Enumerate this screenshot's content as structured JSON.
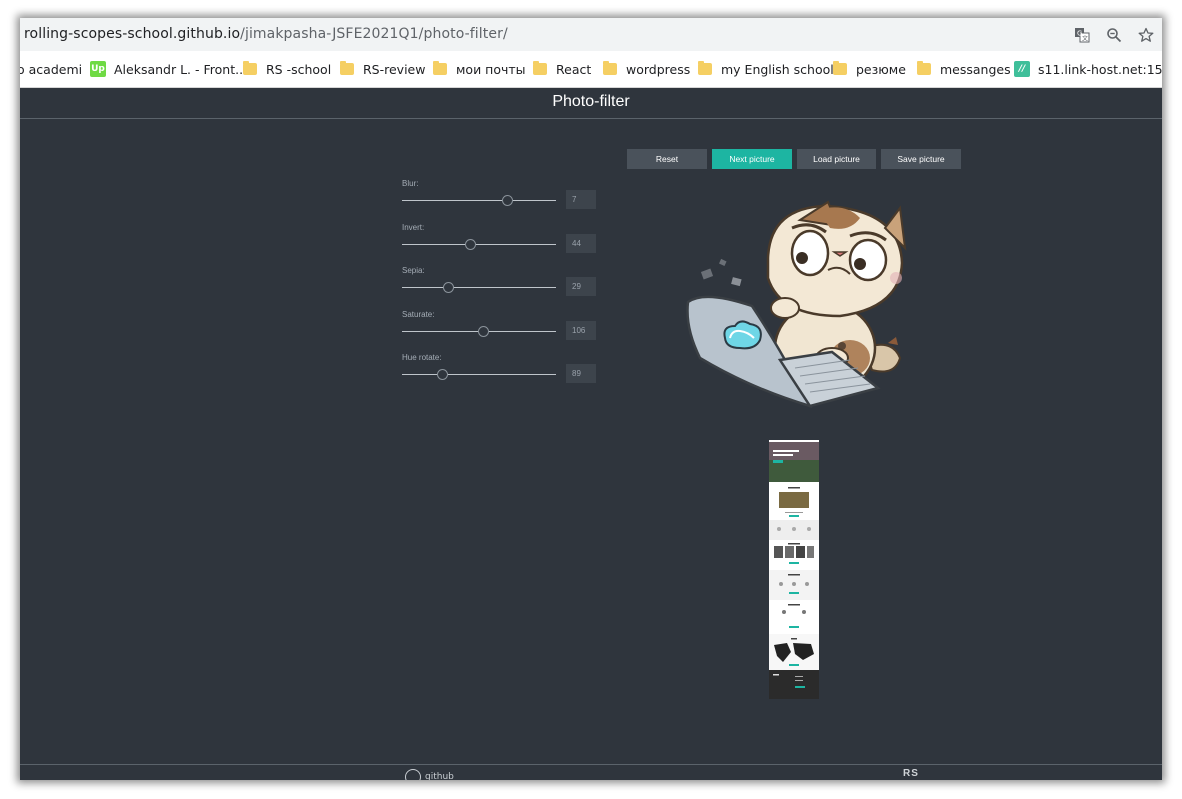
{
  "browser": {
    "url_host": "rolling-scopes-school.github.io",
    "url_path": "/jimakpasha-JSFE2021Q1/photo-filter/",
    "bookmarks": [
      {
        "label": "o academi",
        "icon": "none"
      },
      {
        "label": "Aleksandr L. - Front...",
        "icon": "upwork-icon"
      },
      {
        "label": "RS -school",
        "icon": "folder-icon"
      },
      {
        "label": "RS-review",
        "icon": "folder-icon"
      },
      {
        "label": "мои почты",
        "icon": "folder-icon"
      },
      {
        "label": "React",
        "icon": "folder-icon"
      },
      {
        "label": "wordpress",
        "icon": "folder-icon"
      },
      {
        "label": "my English school",
        "icon": "folder-icon"
      },
      {
        "label": "резюме",
        "icon": "folder-icon"
      },
      {
        "label": "messanges",
        "icon": "folder-icon"
      },
      {
        "label": "s11.link-host.net:15...",
        "icon": "link-host-icon"
      }
    ],
    "icons": [
      "translate-icon",
      "zoom-icon",
      "star-icon"
    ]
  },
  "page": {
    "title": "Photo-filter",
    "buttons": {
      "reset": "Reset",
      "next": "Next picture",
      "load": "Load picture",
      "save": "Save picture"
    },
    "filters": [
      {
        "label": "Blur:",
        "value": "7",
        "min": 0,
        "max": 10
      },
      {
        "label": "Invert:",
        "value": "44",
        "min": 0,
        "max": 100
      },
      {
        "label": "Sepia:",
        "value": "29",
        "min": 0,
        "max": 100
      },
      {
        "label": "Saturate:",
        "value": "106",
        "min": 0,
        "max": 200
      },
      {
        "label": "Hue rotate:",
        "value": "89",
        "min": 0,
        "max": 360
      }
    ],
    "footer": {
      "github": "github",
      "rs_logo": "RS School"
    },
    "colors": {
      "background": "#2f353d",
      "accent": "#1db5a2",
      "button": "#4a525b"
    }
  }
}
